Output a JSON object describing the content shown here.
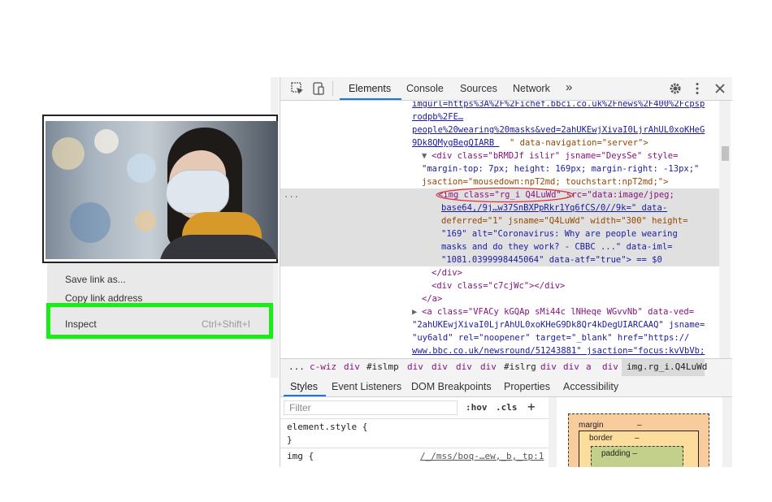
{
  "context_menu": {
    "items": [
      {
        "label": "Save link as..."
      },
      {
        "label": "Copy link address"
      },
      {
        "label": "Inspect",
        "shortcut": "Ctrl+Shift+I"
      }
    ]
  },
  "devtools": {
    "tabs": [
      "Elements",
      "Console",
      "Sources",
      "Network"
    ],
    "more_tabs": "»",
    "code_lines": [
      "imgurl=https%3A%2F%2Fichef.bbci.co.uk%2Fnews%2F400%2Fcpsp",
      "rodpb%2FE…",
      "people%20wearing%20masks&ved=2ahUKEwjXivaI0LjrAhUL0xoKHeG",
      "9Dk8QMygBegQIARB ",
      "\" data-navigation=\"server\">",
      "<div class=\"bRMDJf islir\" jsname=\"DeysSe\" style=",
      "\"margin-top: 7px; height: 169px; margin-right: -13px;\"",
      "jsaction=\"mousedown:npT2md; touchstart:npT2md;\">",
      "<img class=\"rg_i Q4LuWd\" src=\"data:image/jpeg;",
      "base64,/9j…w37SnBXPpRkr1Yq6fCS/0//9k=\" data-",
      "deferred=\"1\" jsname=\"Q4LuWd\" width=\"300\" height=",
      "\"169\" alt=\"Coronavirus: Why are people wearing",
      "masks and do they work? - CBBC ...\" data-iml=",
      "\"1081.0399998445064\" data-atf=\"true\"> == $0",
      "</div>",
      "<div class=\"c7cjWc\"></div>",
      "</a>",
      "<a class=\"VFACy kGQAp sMi44c lNHeqe WGvvNb\" data-ved=",
      "\"2ahUKEwjXivaI0LjrAhUL0xoKHeG9Dk8Qr4kDegUIARCAAQ\" jsname=",
      "\"uy6ald\" rel=\"noopener\" target=\"_blank\" href=\"https://",
      "www.bbc.co.uk/newsround/51243881\" jsaction=\"focus:kvVbVb;"
    ],
    "ellipsis": "...",
    "breadcrumbs": [
      "...",
      "c-wiz",
      "div",
      "#islmp",
      "div",
      "div",
      "div",
      "div",
      "#islrg",
      "div",
      "div",
      "a",
      "div",
      "img.rg_i.Q4LuWd"
    ],
    "subtabs": [
      "Styles",
      "Event Listeners",
      "DOM Breakpoints",
      "Properties",
      "Accessibility"
    ],
    "styles": {
      "filter_placeholder": "Filter",
      "hov": ":hov",
      "cls": ".cls",
      "add": "+",
      "element_style_open": "element.style {",
      "element_style_close": "}",
      "img_rule": "img {",
      "img_source": "/_/mss/boq-…ew,_b,_tp:1"
    },
    "box_model": {
      "margin_label": "margin",
      "margin_value": "–",
      "border_label": "border",
      "border_value": "–",
      "padding_label": "padding –"
    }
  },
  "colors": {
    "highlight_outline": "#16ee16",
    "active_tab_underline": "#1a73e8",
    "tag_color": "#881280",
    "attr_color": "#994500",
    "value_color": "#1a1aa6"
  },
  "icons": [
    "inspect-element-icon",
    "device-toolbar-icon",
    "settings-gear-icon",
    "kebab-menu-icon",
    "close-icon"
  ]
}
